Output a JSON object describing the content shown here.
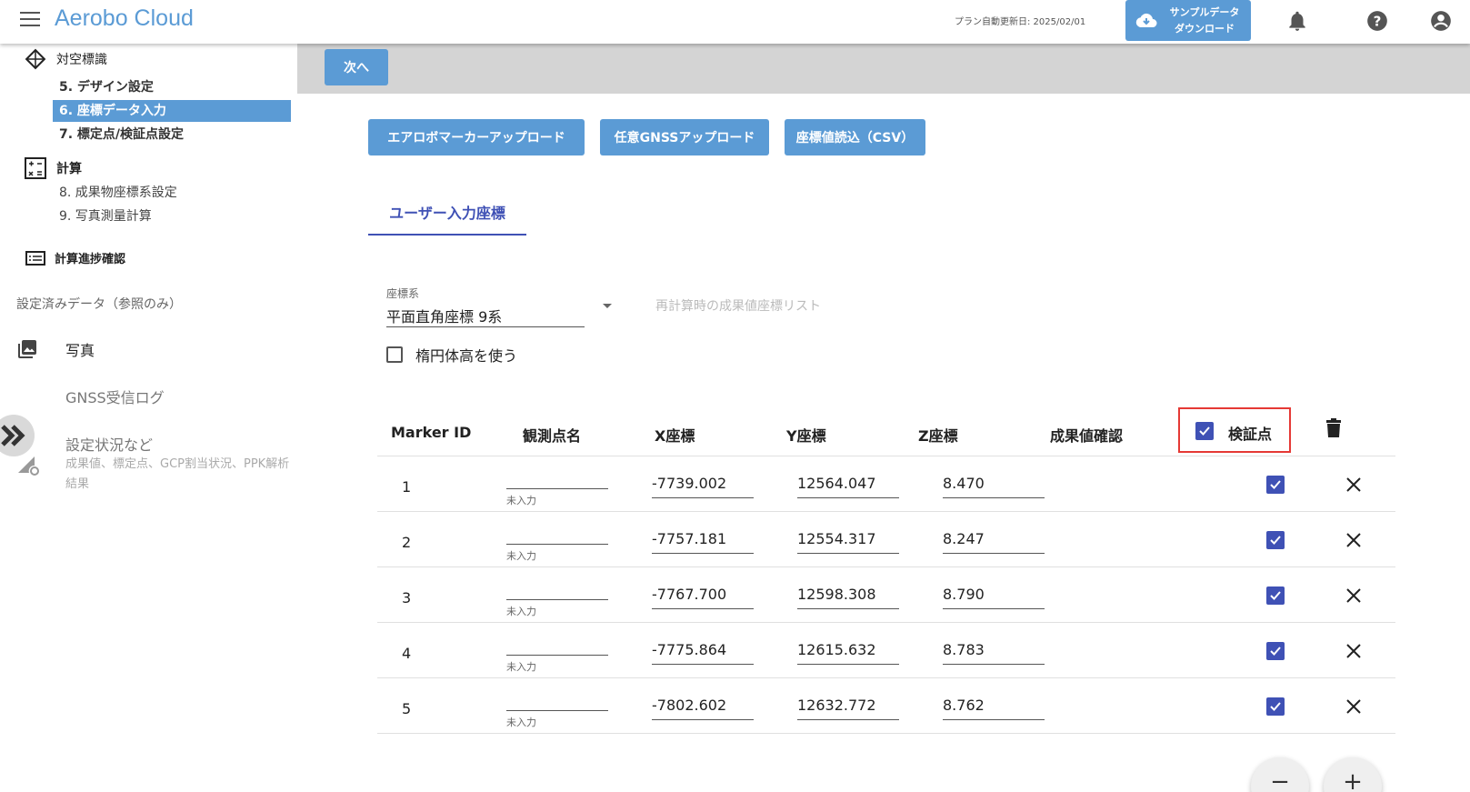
{
  "app": {
    "title": "Aerobo Cloud",
    "plan_renewal": "プラン自動更新日: 2025/02/01",
    "sample_download": [
      "サンプルデータ",
      "ダウンロード"
    ],
    "accent": "#5b9bd5"
  },
  "sidebar": {
    "targets_section": "対空標識",
    "steps": [
      {
        "label": "5. デザイン設定"
      },
      {
        "label": "6. 座標データ入力"
      },
      {
        "label": "7. 標定点/検証点設定"
      }
    ],
    "calc_section": "計算",
    "calc_steps": [
      {
        "label": "8. 成果物座標系設定"
      },
      {
        "label": "9. 写真測量計算"
      }
    ],
    "progress_section": "計算進捗確認",
    "readonly_note": "設定済みデータ（参照のみ）",
    "photos": "写真",
    "gnss_log": "GNSS受信ログ",
    "status_title": "設定状況など",
    "status_sub": "成果値、標定点、GCP割当状況、PPK解析結果"
  },
  "main": {
    "next": "次へ",
    "upload_buttons": [
      "エアロボマーカーアップロード",
      "任意GNSSアップロード",
      "座標値読込（CSV）"
    ],
    "tab_label": "ユーザー入力座標",
    "coord_system_label": "座標系",
    "coord_system_value": "平面直角座標 9系",
    "recalc_list": "再計算時の成果値座標リスト",
    "ellipsoid_label": "楕円体高を使う"
  },
  "table": {
    "headers": {
      "marker_id": "Marker ID",
      "obs_name": "観測点名",
      "x": "X座標",
      "y": "Y座標",
      "z": "Z座標",
      "result": "成果値確認",
      "verify": "検証点"
    },
    "name_placeholder": "未入力",
    "rows": [
      {
        "id": "1",
        "x": "-7739.002",
        "y": "12564.047",
        "z": "8.470"
      },
      {
        "id": "2",
        "x": "-7757.181",
        "y": "12554.317",
        "z": "8.247"
      },
      {
        "id": "3",
        "x": "-7767.700",
        "y": "12598.308",
        "z": "8.790"
      },
      {
        "id": "4",
        "x": "-7775.864",
        "y": "12615.632",
        "z": "8.783"
      },
      {
        "id": "5",
        "x": "-7802.602",
        "y": "12632.772",
        "z": "8.762"
      }
    ]
  },
  "fabs": {
    "minus": "−",
    "plus": "+"
  }
}
